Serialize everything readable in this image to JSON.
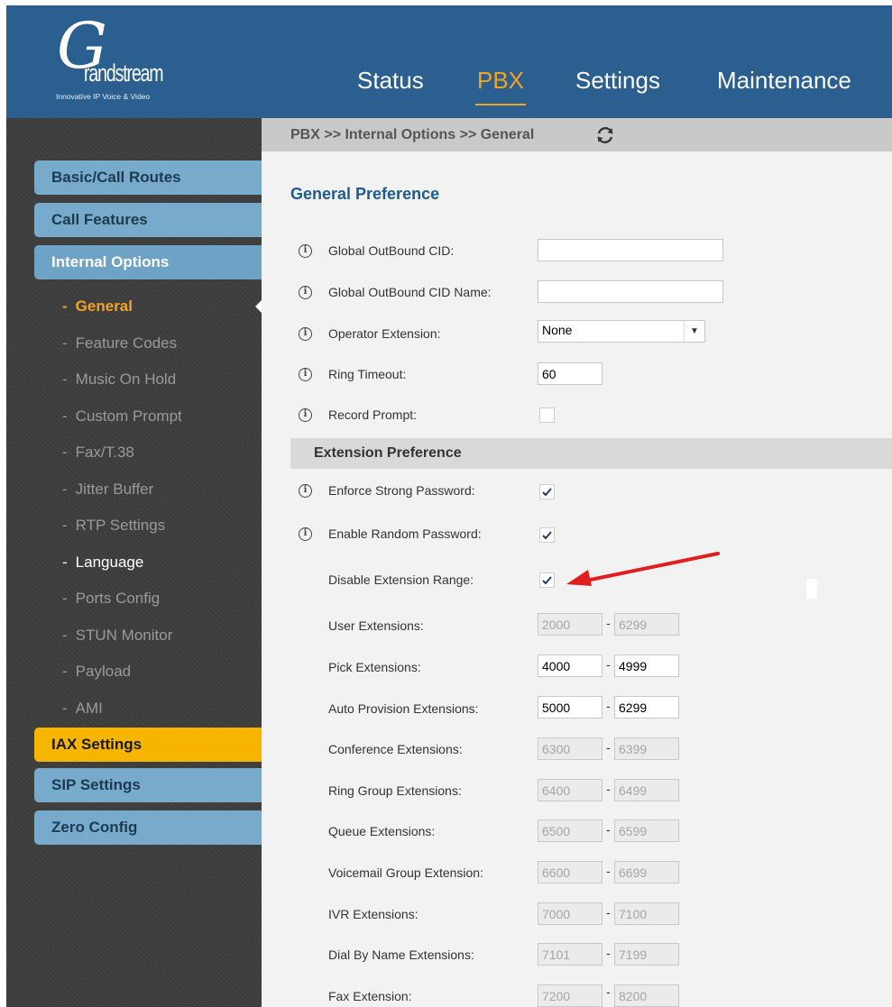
{
  "header": {
    "logo": {
      "mark": "G",
      "word": "randstream",
      "tagline": "Innovative IP Voice & Video"
    },
    "nav": [
      {
        "label": "Status"
      },
      {
        "label": "PBX"
      },
      {
        "label": "Settings"
      },
      {
        "label": "Maintenance"
      }
    ],
    "active_nav": "PBX",
    "accent_color": "#f4a323",
    "header_color": "#2a5f90"
  },
  "sidebar": {
    "tabs": {
      "basic": "Basic/Call Routes",
      "call_features": "Call Features",
      "internal_options": "Internal Options",
      "iax": "IAX Settings",
      "sip": "SIP Settings",
      "zero_config": "Zero Config"
    },
    "sub_items": [
      {
        "label": "General"
      },
      {
        "label": "Feature Codes"
      },
      {
        "label": "Music On Hold"
      },
      {
        "label": "Custom Prompt"
      },
      {
        "label": "Fax/T.38"
      },
      {
        "label": "Jitter Buffer"
      },
      {
        "label": "RTP Settings"
      },
      {
        "label": "Language"
      },
      {
        "label": "Ports Config"
      },
      {
        "label": "STUN Monitor"
      },
      {
        "label": "Payload"
      },
      {
        "label": "AMI"
      }
    ],
    "selected_sub_item": "General",
    "dash": "-"
  },
  "breadcrumb": {
    "text": "PBX >> Internal Options >> General",
    "icon": "refresh-icon"
  },
  "general_preference": {
    "title": "General Preference",
    "global_outbound_cid": {
      "label": "Global OutBound CID:",
      "value": ""
    },
    "global_outbound_cid_name": {
      "label": "Global OutBound CID Name:",
      "value": ""
    },
    "operator_extension": {
      "label": "Operator Extension:",
      "value": "None"
    },
    "ring_timeout": {
      "label": "Ring Timeout:",
      "value": "60"
    },
    "record_prompt": {
      "label": "Record Prompt:",
      "checked": false
    },
    "info_glyph": "i"
  },
  "extension_preference": {
    "title": "Extension Preference",
    "enforce_strong_password": {
      "label": "Enforce Strong Password:",
      "checked": true
    },
    "enable_random_password": {
      "label": "Enable Random Password:",
      "checked": true
    },
    "disable_extension_range": {
      "label": "Disable Extension Range:",
      "checked": true
    },
    "ranges": [
      {
        "label": "User Extensions:",
        "from": "2000",
        "to": "6299",
        "enabled": false
      },
      {
        "label": "Pick Extensions:",
        "from": "4000",
        "to": "4999",
        "enabled": true
      },
      {
        "label": "Auto Provision Extensions:",
        "from": "5000",
        "to": "6299",
        "enabled": true
      },
      {
        "label": "Conference Extensions:",
        "from": "6300",
        "to": "6399",
        "enabled": false
      },
      {
        "label": "Ring Group Extensions:",
        "from": "6400",
        "to": "6499",
        "enabled": false
      },
      {
        "label": "Queue Extensions:",
        "from": "6500",
        "to": "6599",
        "enabled": false
      },
      {
        "label": "Voicemail Group Extension:",
        "from": "6600",
        "to": "6699",
        "enabled": false
      },
      {
        "label": "IVR Extensions:",
        "from": "7000",
        "to": "7100",
        "enabled": false
      },
      {
        "label": "Dial By Name Extensions:",
        "from": "7101",
        "to": "7199",
        "enabled": false
      },
      {
        "label": "Fax Extension:",
        "from": "7200",
        "to": "8200",
        "enabled": false
      }
    ],
    "range_separator": "-"
  },
  "annotation": {
    "arrow_color": "#e02020"
  }
}
